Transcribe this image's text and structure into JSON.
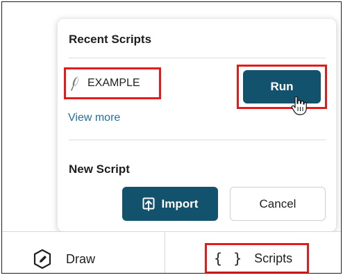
{
  "recent": {
    "title": "Recent Scripts",
    "items": [
      {
        "icon": "feather-icon",
        "label": "EXAMPLE"
      }
    ],
    "run_label": "Run",
    "view_more": "View more"
  },
  "new_script": {
    "title": "New Script",
    "import_label": "Import",
    "cancel_label": "Cancel"
  },
  "toolbar": {
    "draw": {
      "icon": "pencil-hexagon-icon",
      "label": "Draw"
    },
    "scripts": {
      "icon": "curly-braces-icon",
      "glyph": "{ }",
      "label": "Scripts"
    }
  },
  "colors": {
    "primary": "#12526c",
    "link": "#1f6f9e",
    "highlight": "#e31b1b"
  }
}
